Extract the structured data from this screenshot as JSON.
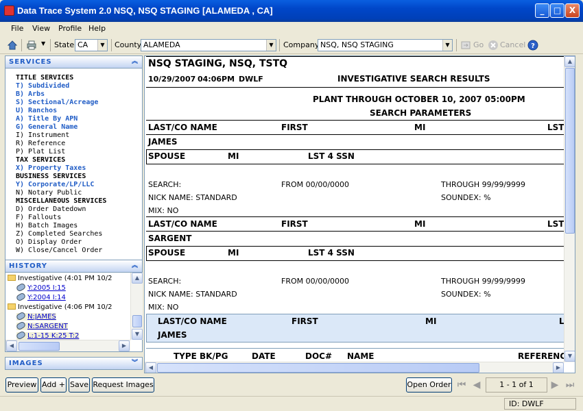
{
  "window": {
    "title": "Data Trace System 2.0 NSQ, NSQ STAGING [ALAMEDA , CA]",
    "min": "_",
    "max": "□",
    "close": "X"
  },
  "menu": [
    "File",
    "View",
    "Profile",
    "Help"
  ],
  "toolbar": {
    "state_label": "State",
    "state_value": "CA",
    "county_label": "County",
    "county_value": "ALAMEDA",
    "company_label": "Company",
    "company_value": "NSQ, NSQ STAGING",
    "go_label": "Go",
    "cancel_label": "Cancel"
  },
  "services": {
    "header": "SERVICES",
    "items": [
      {
        "text": "TITLE SERVICES",
        "kind": "h"
      },
      {
        "text": "T) Subdivided",
        "kind": "lk"
      },
      {
        "text": "B) Arbs",
        "kind": "lk"
      },
      {
        "text": "S) Sectional/Acreage",
        "kind": "lk"
      },
      {
        "text": "U) Ranchos",
        "kind": "lk"
      },
      {
        "text": "A) Title By APN",
        "kind": "lk"
      },
      {
        "text": "G) General Name",
        "kind": "lk"
      },
      {
        "text": "I) Instrument",
        "kind": ""
      },
      {
        "text": "R) Reference",
        "kind": ""
      },
      {
        "text": "P) Plat List",
        "kind": ""
      },
      {
        "text": "TAX SERVICES",
        "kind": "h"
      },
      {
        "text": "X) Property Taxes",
        "kind": "lk"
      },
      {
        "text": "BUSINESS SERVICES",
        "kind": "h"
      },
      {
        "text": "Y) Corporate/LP/LLC",
        "kind": "lk"
      },
      {
        "text": "N) Notary Public",
        "kind": ""
      },
      {
        "text": "MISCELLANEOUS SERVICES",
        "kind": "h"
      },
      {
        "text": "D) Order Datedown",
        "kind": ""
      },
      {
        "text": "F) Fallouts",
        "kind": ""
      },
      {
        "text": "H) Batch Images",
        "kind": ""
      },
      {
        "text": "Z) Completed Searches",
        "kind": ""
      },
      {
        "text": "O) Display Order",
        "kind": ""
      },
      {
        "text": "W) Close/Cancel Order",
        "kind": ""
      }
    ]
  },
  "history": {
    "header": "HISTORY",
    "items": [
      {
        "text": "Investigative (4:01 PM 10/2",
        "kind": "folder",
        "indent": 0
      },
      {
        "text": "Y:2005 I:15",
        "kind": "link",
        "indent": 1
      },
      {
        "text": "Y:2004 I:14",
        "kind": "link",
        "indent": 1
      },
      {
        "text": "Investigative (4:06 PM 10/2",
        "kind": "folder",
        "indent": 0
      },
      {
        "text": "N:JAMES",
        "kind": "link",
        "indent": 1
      },
      {
        "text": "N:SARGENT",
        "kind": "link",
        "indent": 1
      },
      {
        "text": "L:1-15 K:25 T:2",
        "kind": "link",
        "indent": 1
      }
    ]
  },
  "images": {
    "header": "IMAGES"
  },
  "report": {
    "company": "NSQ STAGING, NSQ, TSTQ",
    "date": "10/29/2007",
    "time": "04:06PM",
    "user": "DWLF",
    "title": "INVESTIGATIVE SEARCH RESULTS",
    "plant": "PLANT THROUGH OCTOBER 10, 2007  05:00PM",
    "params": "SEARCH PARAMETERS",
    "col_last": "LAST/CO NAME",
    "col_first": "FIRST",
    "col_mi": "MI",
    "col_lst": "LST",
    "spouse": "SPOUSE",
    "mi": "MI",
    "lst4": "LST 4 SSN",
    "blocks": [
      {
        "name": "JAMES",
        "search": "SEARCH:",
        "from": "FROM 00/00/0000",
        "through": "THROUGH 99/99/9999",
        "nick": "NICK NAME: STANDARD",
        "soundex": "SOUNDEX: %",
        "mix": "MIX: NO"
      },
      {
        "name": "SARGENT",
        "search": "SEARCH:",
        "from": "FROM 00/00/0000",
        "through": "THROUGH 99/99/9999",
        "nick": "NICK NAME: STANDARD",
        "soundex": "SOUNDEX: %",
        "mix": "MIX: NO"
      }
    ],
    "result": {
      "col_last": "LAST/CO NAME",
      "col_first": "FIRST",
      "col_mi": "MI",
      "col_l": "L",
      "name": "JAMES"
    },
    "table": {
      "type": "TYPE",
      "bkpg": "BK/PG",
      "date": "DATE",
      "doc": "DOC#",
      "name": "NAME",
      "ref": "REFERENC"
    }
  },
  "bottom": {
    "preview": "Preview",
    "add": "Add +",
    "save": "Save",
    "request": "Request Images",
    "open": "Open Order",
    "page": "1 - 1 of 1"
  },
  "status": {
    "id": "ID: DWLF"
  }
}
